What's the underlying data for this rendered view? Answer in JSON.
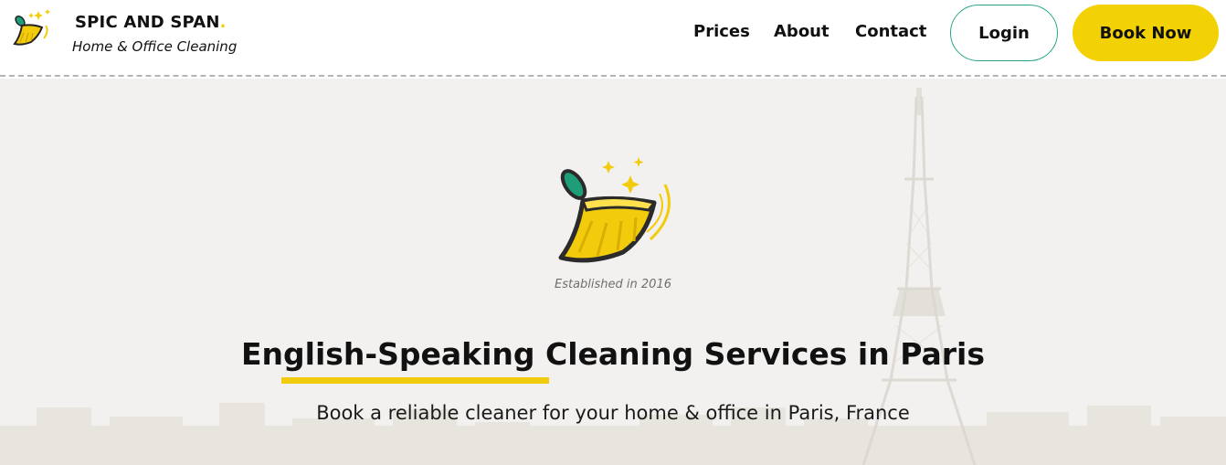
{
  "header": {
    "brand_name": "SPIC AND SPAN",
    "brand_dot": ".",
    "brand_tagline": "Home & Office Cleaning",
    "logo_icon": "broom-sparkle-icon"
  },
  "nav": {
    "items": [
      {
        "label": "Prices"
      },
      {
        "label": "About"
      },
      {
        "label": "Contact"
      }
    ],
    "login_label": "Login",
    "book_label": "Book Now"
  },
  "hero": {
    "logo_icon": "broom-sparkle-icon",
    "established": "Established in 2016",
    "headline": "English-Speaking Cleaning Services in Paris",
    "subline": "Book a reliable cleaner for your home & office in Paris, France",
    "background": "eiffel-tower-paris-skyline"
  },
  "colors": {
    "accent_yellow": "#f2d105",
    "accent_green": "#2aa58a",
    "text": "#111111",
    "hero_bg": "#f2f1ef"
  }
}
